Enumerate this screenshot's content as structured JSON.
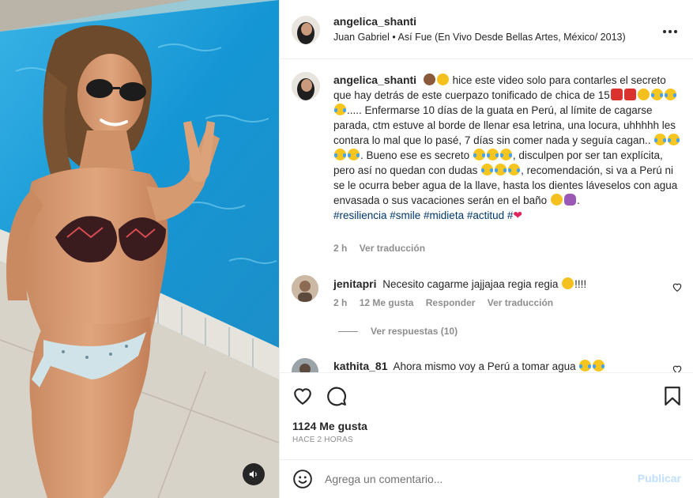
{
  "post": {
    "username": "angelica_shanti",
    "audio_artist": "Juan Gabriel",
    "audio_separator": "•",
    "audio_title": "Así Fue (En Vivo Desde Bellas Artes, México/ 2013)",
    "more_icon": "more-horizontal-icon"
  },
  "caption": {
    "username": "angelica_shanti",
    "text_1": "hice este video solo para contarles el secreto que hay detrás de este cuerpazo tonificado de chica de 15",
    "text_2": "..... Enfermarse 10 días de la guata en Perú, al límite de cagarse parada, ctm estuve al borde de llenar esa letrina, una locura, uhhhhh les contara lo mal que lo pasé, 7 días sin comer nada y seguía cagan..",
    "text_3": ". Bueno ese es secreto",
    "text_4": ", disculpen por ser tan explícita, pero así no quedan con dudas",
    "text_5": ", recomendación, si va a Perú ni se le ocurra beber agua de la llave, hasta los dientes láveselos con agua envasada o sus vacaciones serán en el baño",
    "text_6": ".",
    "hashtags": "#resiliencia #smile #midieta #actitud #",
    "time": "2 h",
    "translate": "Ver traducción"
  },
  "comments": [
    {
      "username": "jenitapri",
      "text": "Necesito cagarme jajjajaa regia regia",
      "suffix": "!!!!",
      "time": "2 h",
      "likes": "12 Me gusta",
      "reply": "Responder",
      "translate": "Ver traducción",
      "view_replies": "Ver respuestas (10)"
    },
    {
      "username": "kathita_81",
      "text": "Ahora mismo voy a Perú a tomar agua"
    }
  ],
  "actions": {
    "likes": "1124 Me gusta",
    "time": "HACE 2 HORAS"
  },
  "add_comment": {
    "placeholder": "Agrega un comentario...",
    "publish": "Publicar"
  },
  "colors": {
    "link": "#00376b",
    "muted": "#8e8e8e",
    "publish_disabled": "#c0dffd",
    "pool": "#1aa3e0"
  }
}
